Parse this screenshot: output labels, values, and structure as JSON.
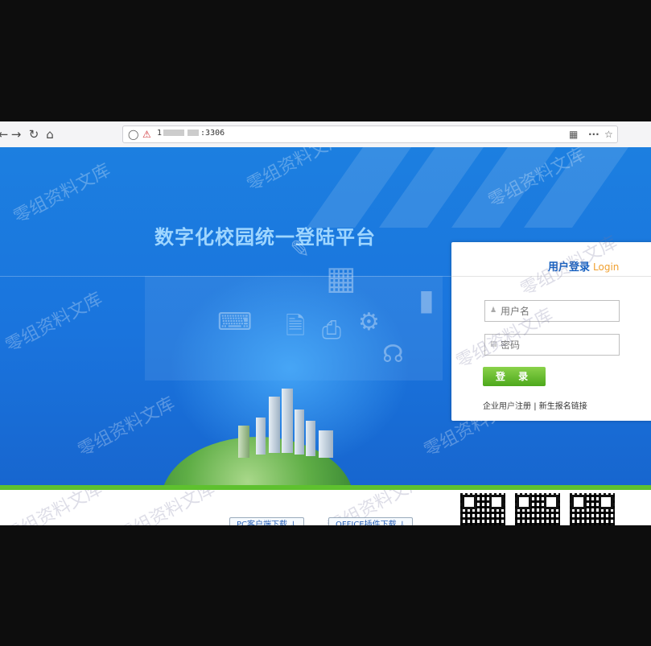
{
  "browser": {
    "back_icon": "arrow-left",
    "forward_icon": "arrow-right",
    "reload_icon": "reload",
    "home_icon": "home",
    "url_prefix": "1",
    "url_suffix": ":3306",
    "menu_glyph": "···",
    "star_glyph": "☆"
  },
  "page": {
    "title": "数字化校园统一登陆平台",
    "watermark": "零组资料文库"
  },
  "login": {
    "title": "用户登录",
    "title_en": "Login",
    "username_placeholder": "用户名",
    "password_placeholder": "密码",
    "submit_label": "登 录",
    "register_link": "企业用户注册",
    "separator": "|",
    "enroll_link": "新生报名链接"
  },
  "footer": {
    "pc_download": "PC客户端下载 ↓",
    "office_download": "OFFICE插件下载 ↓"
  },
  "colors": {
    "hero_blue": "#1a74dd",
    "login_title": "#1660c0",
    "login_accent": "#f0a030",
    "button_green": "#5ec12e"
  }
}
